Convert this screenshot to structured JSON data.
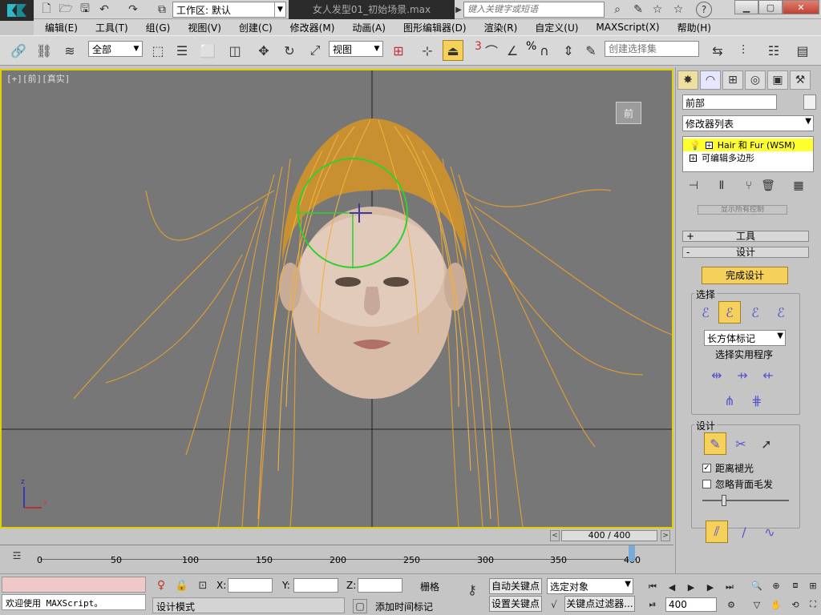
{
  "app": {
    "workspace_label": "工作区: 默认",
    "doc_title": "女人发型01_初始场景.max",
    "search_placeholder": "键入关键字或短语"
  },
  "menu": [
    "编辑(E)",
    "工具(T)",
    "组(G)",
    "视图(V)",
    "创建(C)",
    "修改器(M)",
    "动画(A)",
    "图形编辑器(D)",
    "渲染(R)",
    "自定义(U)",
    "MAXScript(X)",
    "帮助(H)"
  ],
  "toolbar": {
    "filter_value": "全部",
    "refcoord_value": "视图",
    "snap_num": "3",
    "angle_num": "%",
    "named_sel_placeholder": "创建选择集"
  },
  "viewport": {
    "label": "[+][前][真实]",
    "viewcube_label": "前",
    "axis_x": "x",
    "axis_z": "z"
  },
  "panel": {
    "object_name": "前部",
    "modifier_list": "修改器列表",
    "stack": [
      "Hair 和 Fur (WSM)",
      "可编辑多边形"
    ],
    "partial_button": "显示所有控制",
    "rollout_tools": "工具",
    "rollout_design": "设计",
    "finish_design": "完成设计",
    "group_select": "选择",
    "box_marker": "长方体标记",
    "select_utils": "选择实用程序",
    "group_design": "设计",
    "chk_distance": "距离褪光",
    "chk_ignore_back": "忽略背面毛发"
  },
  "timeline": {
    "frame_display": "400 / 400",
    "ticks": [
      "0",
      "50",
      "100",
      "150",
      "200",
      "250",
      "300",
      "350",
      "400"
    ]
  },
  "status": {
    "maxscript_listener": "欢迎使用 MAXScript。",
    "prompt": "设计模式",
    "x_label": "X:",
    "y_label": "Y:",
    "z_label": "Z:",
    "grid_label": "栅格",
    "auto_key": "自动关键点",
    "set_key": "设置关键点",
    "selected_object": "选定对象",
    "key_filters": "关键点过滤器...",
    "add_time_tag": "添加时间标记",
    "current_frame": "400"
  },
  "colors": {
    "viewport_bg": "#777777",
    "active_border": "#e0d000",
    "hair": "#e8a030",
    "gizmo": "#30d030",
    "finish_button": "#f5d05a",
    "stack_selected": "#ffff30"
  },
  "icons": [
    "app-logo-icon",
    "new-file-icon",
    "open-file-icon",
    "save-icon",
    "undo-icon",
    "redo-icon",
    "project-icon",
    "search-binoculars-icon",
    "communication-icon",
    "star-icon",
    "help-icon",
    "minimize-icon",
    "maximize-icon",
    "close-icon",
    "select-link-icon",
    "unlink-icon",
    "bind-spacewarp-icon",
    "select-object-icon",
    "select-by-name-icon",
    "rect-region-icon",
    "window-crossing-icon",
    "move-icon",
    "rotate-icon",
    "scale-icon",
    "pivot-icon",
    "manipulate-icon",
    "keyboard-shortcut-icon",
    "snap-icon",
    "angle-snap-icon",
    "percent-snap-icon",
    "spinner-snap-icon",
    "mirror-icon",
    "align-icon",
    "layer-icon",
    "lightbulb-icon",
    "pin-stack-icon",
    "show-end-result-icon",
    "make-unique-icon",
    "remove-modifier-icon",
    "configure-sets-icon",
    "play-icon",
    "prev-frame-icon",
    "next-frame-icon",
    "go-start-icon",
    "go-end-icon",
    "key-mode-icon",
    "zoom-icon",
    "pan-icon",
    "orbit-icon",
    "maximize-viewport-icon",
    "lock-icon"
  ]
}
